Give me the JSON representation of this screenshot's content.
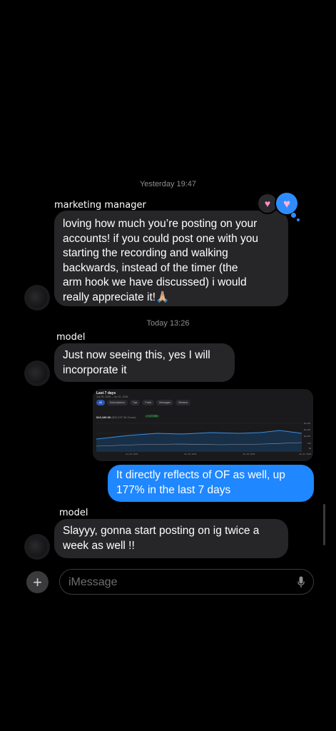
{
  "conversation": {
    "timestamps": [
      "Yesterday 19:47",
      "Today 13:26"
    ],
    "messages": [
      {
        "sender": "marketing manager",
        "direction": "incoming",
        "lines": [
          "loving how much you’re posting on your",
          "accounts! if you could post one with you",
          "starting the recording and walking",
          "backwards, instead of the timer (the",
          "arm hook we have discussed) i would",
          "really appreciate it!🙏🏼"
        ],
        "tapbacks": [
          "heart-icon",
          "heart-icon"
        ]
      },
      {
        "sender": "model",
        "direction": "incoming",
        "lines": [
          "Just now seeing this, yes I will",
          "incorporate it"
        ]
      },
      {
        "direction": "outgoing",
        "type": "image"
      },
      {
        "direction": "outgoing",
        "lines": [
          "It directly reflects of OF as well, up",
          "177% in the last 7 days"
        ]
      },
      {
        "sender": "model",
        "direction": "incoming",
        "lines": [
          "Slayyy, gonna start posting on ig twice a",
          "week as well !!"
        ]
      }
    ]
  },
  "screenshot_card": {
    "title": "Last 7 days",
    "subtitle": "Jun 25, 2025 – Jun 31, 2025",
    "tabs": [
      "All",
      "Subscriptions",
      "Tips",
      "Posts",
      "Messages",
      "Streams"
    ],
    "total": "$16,189.99",
    "total_gross": "($20,237.36 Gross)",
    "change": "↗ 177.5%",
    "y_ticks": [
      "$6,000",
      "$4,000",
      "$2,000",
      "100",
      "$0"
    ],
    "x_ticks": [
      "Jun 25, 2025",
      "Jun 26, 2025",
      "Jun 28, 2025",
      "Jun 31, 2025"
    ]
  },
  "composer": {
    "placeholder": "iMessage",
    "plus_icon": "plus-icon",
    "mic_icon": "mic-icon"
  },
  "colors": {
    "background": "#000000",
    "incoming_bubble": "#262629",
    "outgoing_bubble": "#1f87ff",
    "timestamp": "#8e8e93"
  }
}
